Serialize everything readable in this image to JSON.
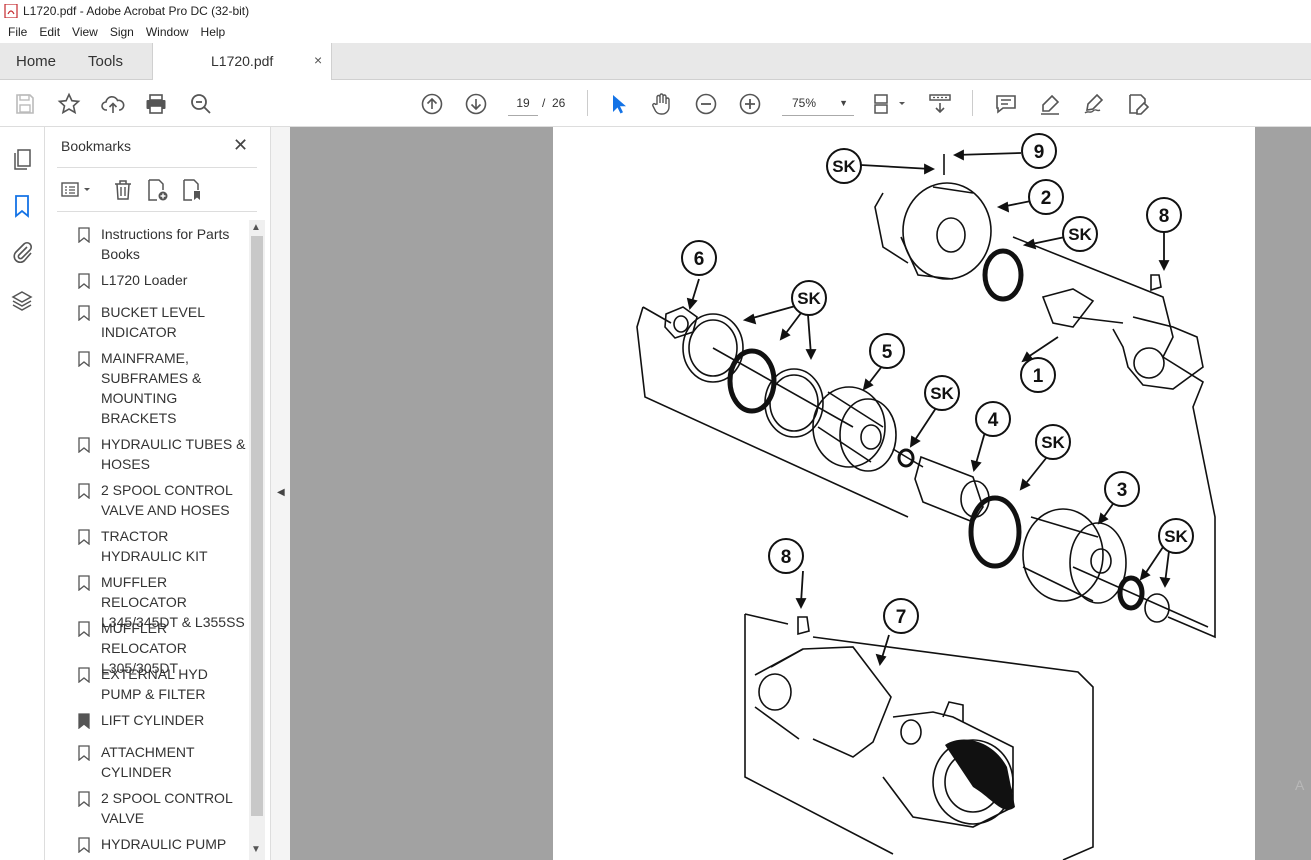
{
  "window": {
    "title": "L1720.pdf - Adobe Acrobat Pro DC (32-bit)"
  },
  "menu": [
    "File",
    "Edit",
    "View",
    "Sign",
    "Window",
    "Help"
  ],
  "tabs": {
    "home": "Home",
    "tools": "Tools",
    "document": "L1720.pdf",
    "close": "×"
  },
  "toolbar": {
    "current_page": "19",
    "separator": "/",
    "total_pages": "26",
    "zoom": "75%",
    "zoom_caret": "▼"
  },
  "bookmarks": {
    "title": "Bookmarks",
    "close": "✕",
    "items": [
      "Instructions for Parts Books",
      "L1720 Loader",
      "BUCKET LEVEL INDICATOR",
      "MAINFRAME, SUBFRAMES & MOUNTING BRACKETS",
      "HYDRAULIC TUBES & HOSES",
      "2 SPOOL CONTROL VALVE AND HOSES",
      "TRACTOR HYDRAULIC KIT",
      "MUFFLER RELOCATOR L345/345DT & L355SS",
      "MUFFLER RELOCATOR L305/305DT",
      "EXTERNAL HYD PUMP & FILTER",
      "LIFT CYLINDER",
      "ATTACHMENT CYLINDER",
      "2 SPOOL CONTROL VALVE",
      "HYDRAULIC PUMP"
    ]
  },
  "diagram": {
    "callouts": [
      "9",
      "2",
      "8",
      "6",
      "1",
      "5",
      "4",
      "3",
      "8",
      "7"
    ],
    "sk_label": "SK"
  },
  "watermark": "A"
}
